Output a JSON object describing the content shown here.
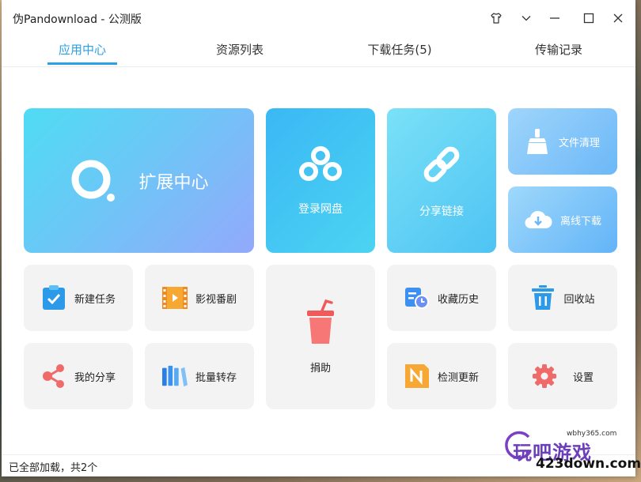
{
  "window": {
    "title": "伪Pandownload - 公测版"
  },
  "tabs": [
    {
      "label": "应用中心",
      "active": true
    },
    {
      "label": "资源列表",
      "active": false
    },
    {
      "label": "下载任务(5)",
      "active": false
    },
    {
      "label": "传输记录",
      "active": false
    }
  ],
  "tiles": {
    "extension": "扩展中心",
    "login": "登录网盘",
    "share_link": "分享链接",
    "file_clean": "文件清理",
    "offline": "离线下载",
    "new_task": "新建任务",
    "movies": "影视番剧",
    "donate": "捐助",
    "history": "收藏历史",
    "recycle": "回收站",
    "my_share": "我的分享",
    "batch": "批量转存",
    "update": "检测更新",
    "settings": "设置"
  },
  "status": {
    "text": "已全部加载，共2个"
  },
  "watermark": {
    "site_small": "wbhy365.com",
    "brand": "玩吧游戏",
    "site": "423down.com"
  },
  "colors": {
    "accent": "#2aa0e6"
  }
}
